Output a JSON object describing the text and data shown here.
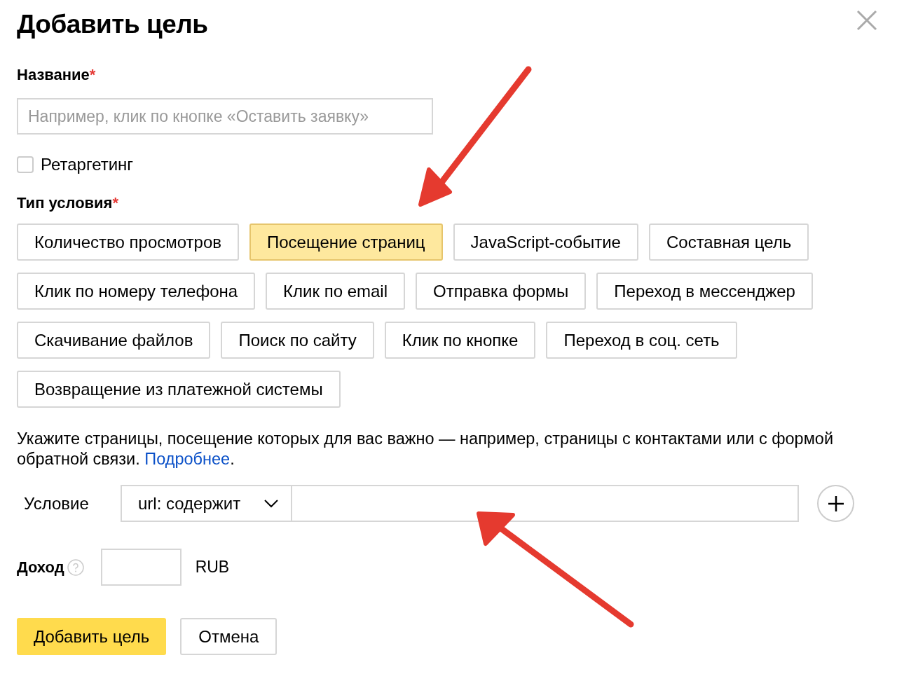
{
  "title": "Добавить цель",
  "name_field": {
    "label": "Название",
    "required_mark": "*",
    "placeholder": "Например, клик по кнопке «Оставить заявку»"
  },
  "retargeting": {
    "label": "Ретаргетинг",
    "checked": false
  },
  "condition_type": {
    "label": "Тип условия",
    "required_mark": "*",
    "options": [
      {
        "label": "Количество просмотров",
        "selected": false
      },
      {
        "label": "Посещение страниц",
        "selected": true
      },
      {
        "label": "JavaScript-событие",
        "selected": false
      },
      {
        "label": "Составная цель",
        "selected": false
      },
      {
        "label": "Клик по номеру телефона",
        "selected": false
      },
      {
        "label": "Клик по email",
        "selected": false
      },
      {
        "label": "Отправка формы",
        "selected": false
      },
      {
        "label": "Переход в мессенджер",
        "selected": false
      },
      {
        "label": "Скачивание файлов",
        "selected": false
      },
      {
        "label": "Поиск по сайту",
        "selected": false
      },
      {
        "label": "Клик по кнопке",
        "selected": false
      },
      {
        "label": "Переход в соц. сеть",
        "selected": false
      },
      {
        "label": "Возвращение из платежной системы",
        "selected": false
      }
    ]
  },
  "description": {
    "text": "Укажите страницы, посещение которых для вас важно — например, страницы с контактами или с формой обратной связи.",
    "link": "Подробнее",
    "after": "."
  },
  "condition": {
    "label": "Условие",
    "select_value": "url: содержит"
  },
  "income": {
    "label": "Доход",
    "currency": "RUB"
  },
  "buttons": [
    {
      "label": "Добавить цель",
      "kind": "primary"
    },
    {
      "label": "Отмена",
      "kind": "secondary"
    }
  ]
}
